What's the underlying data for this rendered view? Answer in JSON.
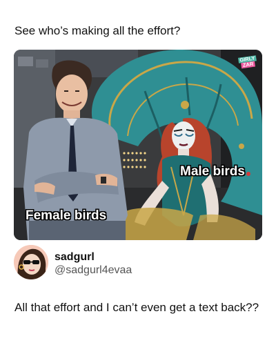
{
  "post": {
    "caption": "See who’s making all the effort?"
  },
  "meme": {
    "male_label": "Male birds",
    "female_label": "Female birds",
    "brand": {
      "line1": "GIRLY",
      "line2": "ZAR"
    }
  },
  "tweet": {
    "display_name": "sadgurl",
    "handle": "@sadgurl4evaa",
    "text": "All that effort and I can’t even get a text back??"
  },
  "colors": {
    "costume_teal": "#2f8f93",
    "costume_gold": "#c9a748",
    "stage_dark": "#2b2c2e",
    "suit_gray": "#8e9aab",
    "tie_navy": "#1e2538",
    "wig_red": "#b8442c"
  }
}
